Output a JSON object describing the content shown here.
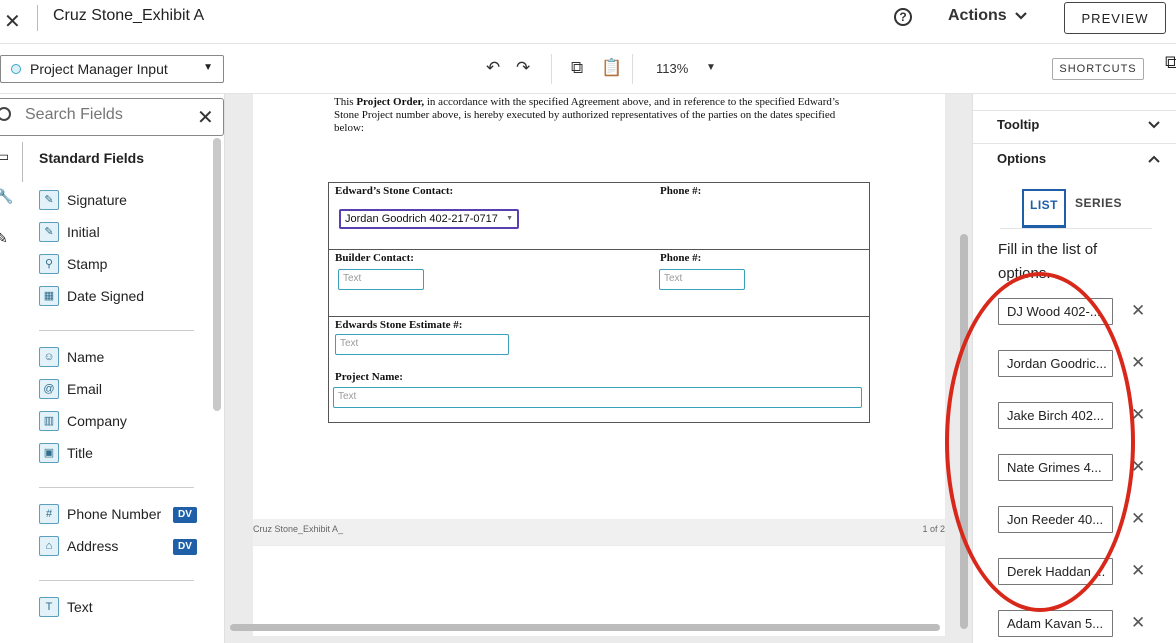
{
  "header": {
    "document_title": "Cruz Stone_Exhibit A",
    "actions_label": "Actions",
    "preview_label": "PREVIEW"
  },
  "toolbar": {
    "recipient": "Project Manager Input",
    "zoom": "113%",
    "shortcuts_label": "SHORTCUTS"
  },
  "left_panel": {
    "search_placeholder": "Search Fields",
    "section_title": "Standard Fields",
    "groups": [
      {
        "items": [
          {
            "label": "Signature",
            "icon": "pen-icon"
          },
          {
            "label": "Initial",
            "icon": "pen-icon"
          },
          {
            "label": "Stamp",
            "icon": "stamp-icon"
          },
          {
            "label": "Date Signed",
            "icon": "calendar-icon"
          }
        ]
      },
      {
        "items": [
          {
            "label": "Name",
            "icon": "person-icon"
          },
          {
            "label": "Email",
            "icon": "at-icon"
          },
          {
            "label": "Company",
            "icon": "building-icon"
          },
          {
            "label": "Title",
            "icon": "briefcase-icon"
          }
        ]
      },
      {
        "items": [
          {
            "label": "Phone Number",
            "icon": "hash-icon",
            "badge": "DV"
          },
          {
            "label": "Address",
            "icon": "home-icon",
            "badge": "DV"
          }
        ]
      },
      {
        "items": [
          {
            "label": "Text",
            "icon": "text-icon"
          }
        ]
      }
    ]
  },
  "document": {
    "intro_prefix": "This ",
    "intro_bold": "Project Order,",
    "intro_line1_rest": " in accordance with the specified Agreement above, and in reference to the specified Edward’s",
    "intro_line2": "Stone Project number above, is hereby executed by authorized representatives of the parties on the dates specified",
    "intro_line3": "below:",
    "edwards_contact_label": "Edward’s Stone Contact:",
    "phone_label_1": "Phone #:",
    "contact_dropdown_value": "Jordan Goodrich 402-217-0717",
    "builder_contact_label": "Builder Contact:",
    "phone_label_2": "Phone #:",
    "estimate_label": "Edwards Stone Estimate #:",
    "project_name_label": "Project Name:",
    "text_placeholder": "Text",
    "footer_left": "Cruz Stone_Exhibit A_",
    "footer_right": "1 of 2"
  },
  "right_panel": {
    "tooltip_label": "Tooltip",
    "options_label": "Options",
    "tab_list": "LIST",
    "tab_series": "SERIES",
    "instructions": "Fill in the list of options.",
    "options": [
      "DJ Wood 402-...",
      "Jordan Goodric...",
      "Jake Birch 402...",
      "Nate Grimes 4...",
      "Jon Reeder 40...",
      "Derek Haddan ...",
      "Adam Kavan 5..."
    ]
  },
  "colors": {
    "accent_blue": "#1e5fa8",
    "field_teal": "#3aa0b8",
    "dropdown_purple": "#5a3fb0",
    "annotation_red": "#d7281a"
  }
}
